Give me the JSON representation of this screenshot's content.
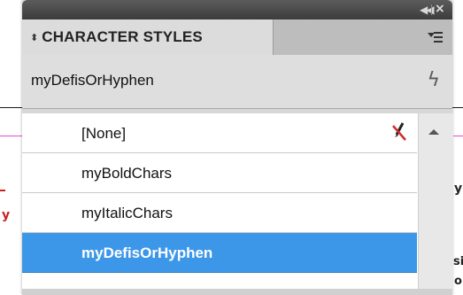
{
  "panel": {
    "title": "CHARACTER STYLES",
    "current_style": "myDefisOrHyphen",
    "styles": [
      {
        "label": "[None]",
        "selected": false,
        "no_edit_icon": true
      },
      {
        "label": "myBoldChars",
        "selected": false,
        "no_edit_icon": false
      },
      {
        "label": "myItalicChars",
        "selected": false,
        "no_edit_icon": false
      },
      {
        "label": "myDefisOrHyphen",
        "selected": true,
        "no_edit_icon": false
      }
    ],
    "icons": {
      "collapse": "collapse-panel-icon",
      "close": "close-icon",
      "tab_arrows": "tab-updown-icon",
      "panel_menu": "panel-menu-icon",
      "lightning": "quick-apply-icon",
      "no_edit": "no-edit-pencil-icon",
      "scroll_up": "scroll-up-arrow-icon"
    }
  },
  "document_fragments": {
    "left_char": "y",
    "right_chars": [
      "y",
      "si",
      "o"
    ]
  },
  "colors": {
    "selection": "#3d97e8",
    "topbar": "#4a4a4a",
    "magenta_guide": "#e24ad8",
    "red_text": "#c82020"
  }
}
